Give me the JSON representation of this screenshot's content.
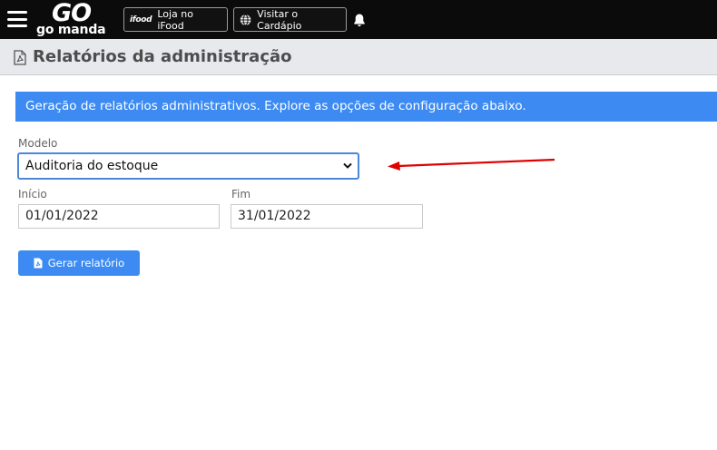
{
  "topbar": {
    "logo_top": "GO",
    "logo_bottom": "go manda",
    "ifood_icon_text": "ifood",
    "ifood_button": "Loja no iFood",
    "cardapio_button": "Visitar o Cardápio"
  },
  "page": {
    "title": "Relatórios da administração",
    "banner": "Geração de relatórios administrativos. Explore as opções de configuração abaixo."
  },
  "form": {
    "modelo_label": "Modelo",
    "modelo_value": "Auditoria do estoque",
    "inicio_label": "Início",
    "inicio_value": "01/01/2022",
    "fim_label": "Fim",
    "fim_value": "31/01/2022",
    "submit_label": "Gerar relatório"
  },
  "colors": {
    "topbar": "#0b0b0b",
    "primary": "#3d8bf2",
    "annotation_arrow": "#e00000"
  }
}
